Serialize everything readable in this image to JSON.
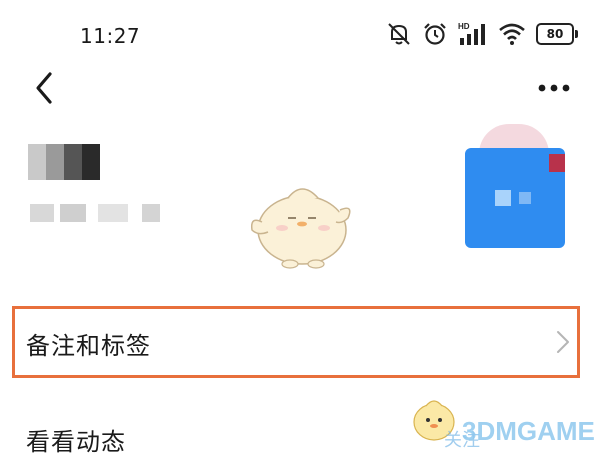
{
  "status_bar": {
    "time": "11:27",
    "signal_tag": "HD",
    "battery": "80",
    "icons": [
      "mute-vibrate-icon",
      "alarm-icon",
      "signal-icon",
      "wifi-icon",
      "battery-icon"
    ]
  },
  "nav": {
    "back_icon": "chevron-left-icon",
    "more_icon": "more-dots-icon"
  },
  "menu": {
    "remarks_label": "备注和标签",
    "moments_label": "看看动态"
  },
  "watermark": {
    "text": "3DMGAME",
    "partial_text": "关注"
  },
  "colors": {
    "highlight": "#e8703c",
    "avatar_blue": "#2f8cf0"
  }
}
